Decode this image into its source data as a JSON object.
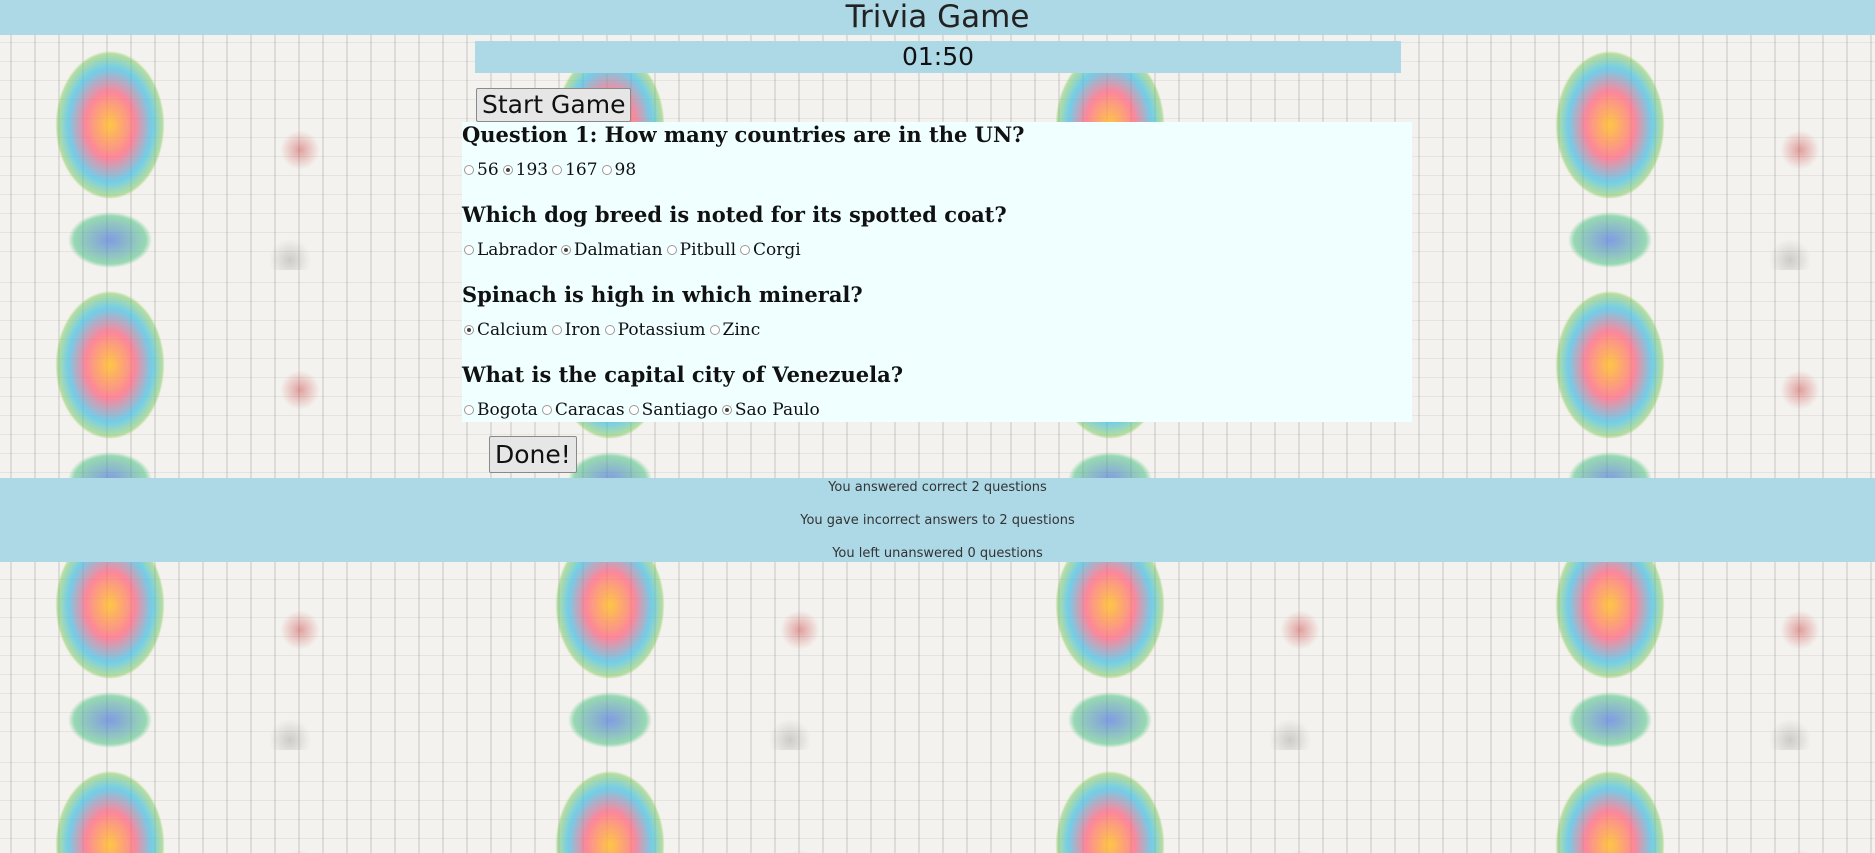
{
  "header": {
    "title": "Trivia Game"
  },
  "timer": {
    "value": "01:50"
  },
  "controls": {
    "start_label": "Start Game",
    "done_label": "Done!"
  },
  "questions": [
    {
      "text": "Question 1: How many countries are in the UN?",
      "options": [
        "56",
        "193",
        "167",
        "98"
      ],
      "selected": 1
    },
    {
      "text": "Which dog breed is noted for its spotted coat?",
      "options": [
        "Labrador",
        "Dalmatian",
        "Pitbull",
        "Corgi"
      ],
      "selected": 1
    },
    {
      "text": "Spinach is high in which mineral?",
      "options": [
        "Calcium",
        "Iron",
        "Potassium",
        "Zinc"
      ],
      "selected": 0
    },
    {
      "text": "What is the capital city of Venezuela?",
      "options": [
        "Bogota",
        "Caracas",
        "Santiago",
        "Sao Paulo"
      ],
      "selected": 3
    }
  ],
  "results": {
    "correct": "You answered correct 2 questions",
    "incorrect": "You gave incorrect answers to 2 questions",
    "unanswered": "You left unanswered 0 questions"
  },
  "colors": {
    "bar": "#add8e6",
    "quiz_panel": "#f0ffff"
  }
}
